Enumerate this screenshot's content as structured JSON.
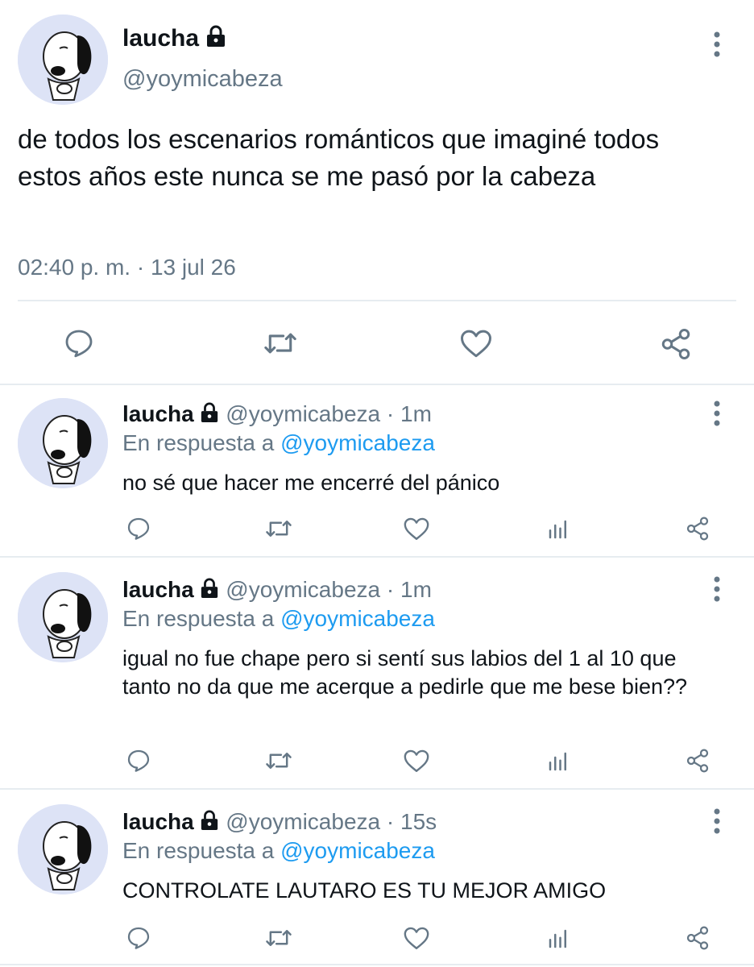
{
  "main_tweet": {
    "display_name": "laucha",
    "handle": "@yoymicabeza",
    "text": "de todos los escenarios románticos que imaginé todos estos años este nunca se me pasó por la cabeza",
    "timestamp": "02:40 p. m. · 13 jul 26",
    "icons": [
      "reply-icon",
      "retweet-icon",
      "like-icon",
      "share-icon"
    ]
  },
  "replies": [
    {
      "display_name": "laucha",
      "handle": "@yoymicabeza",
      "time": "· 1m",
      "reply_prefix": "En respuesta a",
      "reply_to": "@yoymicabeza",
      "text": "no sé que hacer me encerré del pánico"
    },
    {
      "display_name": "laucha",
      "handle": "@yoymicabeza",
      "time": "· 1m",
      "reply_prefix": "En respuesta a",
      "reply_to": "@yoymicabeza",
      "text": "igual no fue chape pero si sentí sus labios del 1 al 10 que tanto no da que me acerque a pedirle que me bese bien??"
    },
    {
      "display_name": "laucha",
      "handle": "@yoymicabeza",
      "time": "· 15s",
      "reply_prefix": "En respuesta a",
      "reply_to": "@yoymicabeza",
      "text": "CONTROLATE LAUTARO ES TU MEJOR AMIGO"
    }
  ],
  "colors": {
    "text": "#0f1419",
    "muted": "#657786",
    "link": "#1d9bf0",
    "divider": "#e6ecf0",
    "avatar_bg": "#dde3f6"
  }
}
